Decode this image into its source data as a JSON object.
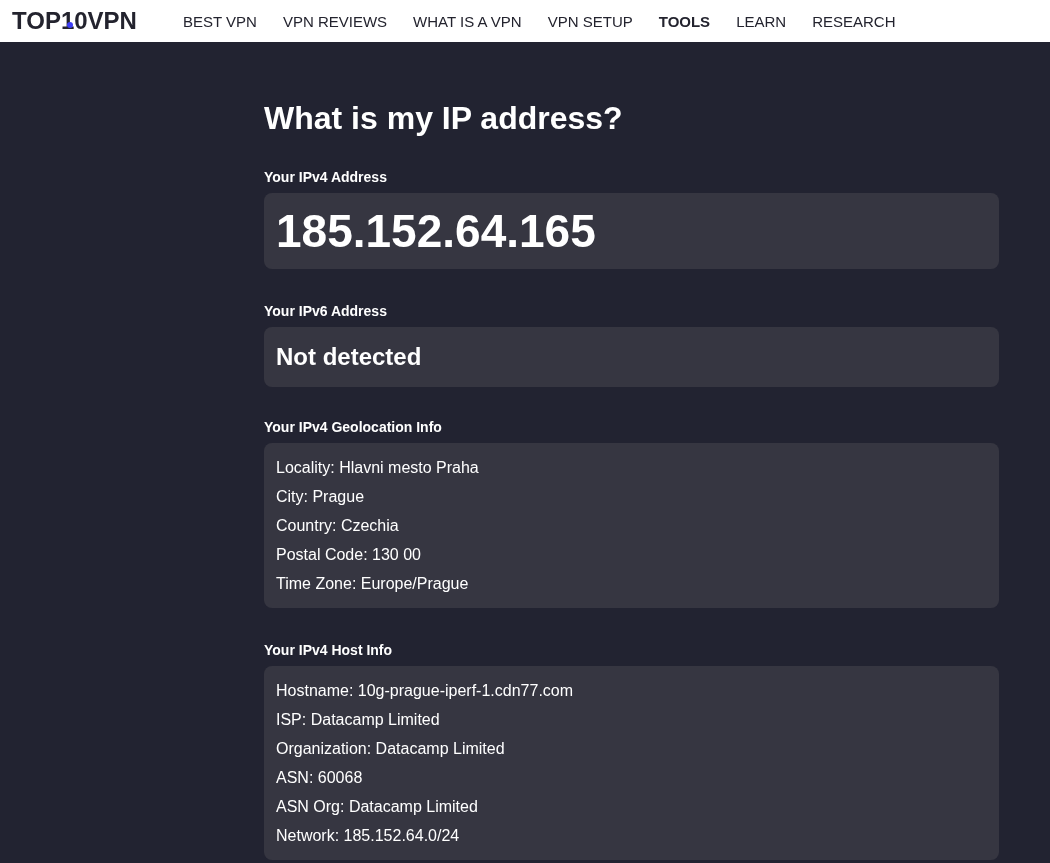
{
  "header": {
    "logo": "TOP10VPN",
    "nav": [
      {
        "label": "BEST VPN",
        "selected": false
      },
      {
        "label": "VPN REVIEWS",
        "selected": false
      },
      {
        "label": "WHAT IS A VPN",
        "selected": false
      },
      {
        "label": "VPN SETUP",
        "selected": false
      },
      {
        "label": "TOOLS",
        "selected": true
      },
      {
        "label": "LEARN",
        "selected": false
      },
      {
        "label": "RESEARCH",
        "selected": false
      }
    ]
  },
  "title": "What is my IP address?",
  "sections": [
    {
      "kind": "big-value",
      "label": "Your IPv4 Address",
      "value": "185.152.64.165"
    },
    {
      "kind": "value",
      "label": "Your IPv6 Address",
      "value": "Not detected"
    },
    {
      "kind": "list",
      "label": "Your IPv4 Geolocation Info",
      "lines": [
        "Locality: Hlavni mesto Praha",
        "City: Prague",
        "Country: Czechia",
        "Postal Code: 130 00",
        "Time Zone: Europe/Prague"
      ]
    },
    {
      "kind": "list",
      "label": "Your IPv4 Host Info",
      "lines": [
        "Hostname: 10g-prague-iperf-1.cdn77.com",
        "ISP: Datacamp Limited",
        "Organization: Datacamp Limited",
        "ASN: 60068",
        "ASN Org: Datacamp Limited",
        "Network: 185.152.64.0/24"
      ]
    }
  ]
}
